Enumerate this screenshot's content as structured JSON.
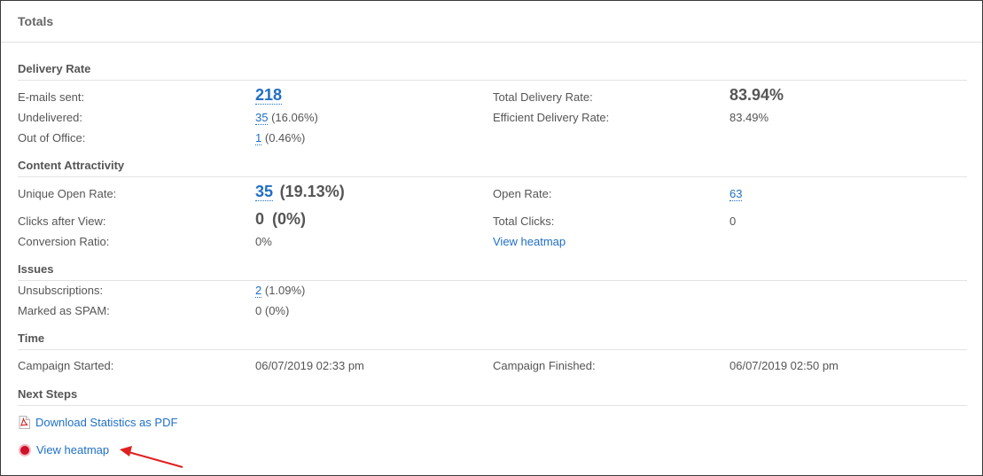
{
  "panel": {
    "title": "Totals"
  },
  "delivery": {
    "title": "Delivery Rate",
    "emails_sent_label": "E-mails sent:",
    "emails_sent_value": "218",
    "undelivered_label": "Undelivered:",
    "undelivered_value": "35",
    "undelivered_pct": "(16.06%)",
    "ooo_label": "Out of Office:",
    "ooo_value": "1",
    "ooo_pct": "(0.46%)",
    "total_rate_label": "Total Delivery Rate:",
    "total_rate_value": "83.94%",
    "efficient_rate_label": "Efficient Delivery Rate:",
    "efficient_rate_value": "83.49%"
  },
  "content": {
    "title": "Content Attractivity",
    "unique_open_label": "Unique Open Rate:",
    "unique_open_value": "35",
    "unique_open_pct": "(19.13%)",
    "open_rate_label": "Open Rate:",
    "open_rate_value": "63",
    "clicks_view_label": "Clicks after View:",
    "clicks_view_value": "0",
    "clicks_view_pct": "(0%)",
    "total_clicks_label": "Total Clicks:",
    "total_clicks_value": "0",
    "conversion_label": "Conversion Ratio:",
    "conversion_value": "0%",
    "heatmap_link": "View heatmap"
  },
  "issues": {
    "title": "Issues",
    "unsub_label": "Unsubscriptions:",
    "unsub_value": "2",
    "unsub_pct": "(1.09%)",
    "spam_label": "Marked as SPAM:",
    "spam_value": "0",
    "spam_pct": "(0%)"
  },
  "time": {
    "title": "Time",
    "started_label": "Campaign Started:",
    "started_value": "06/07/2019 02:33 pm",
    "finished_label": "Campaign Finished:",
    "finished_value": "06/07/2019 02:50 pm"
  },
  "next_steps": {
    "title": "Next Steps",
    "download_pdf": "Download Statistics as PDF",
    "view_heatmap": "View heatmap"
  },
  "icons": {
    "pdf": "pdf-icon",
    "heatmap": "heatmap-dot-icon",
    "arrow": "annotation-arrow"
  },
  "colors": {
    "link": "#1f6fc6",
    "heatmap_dot": "#d0102a",
    "arrow": "#e02020"
  }
}
